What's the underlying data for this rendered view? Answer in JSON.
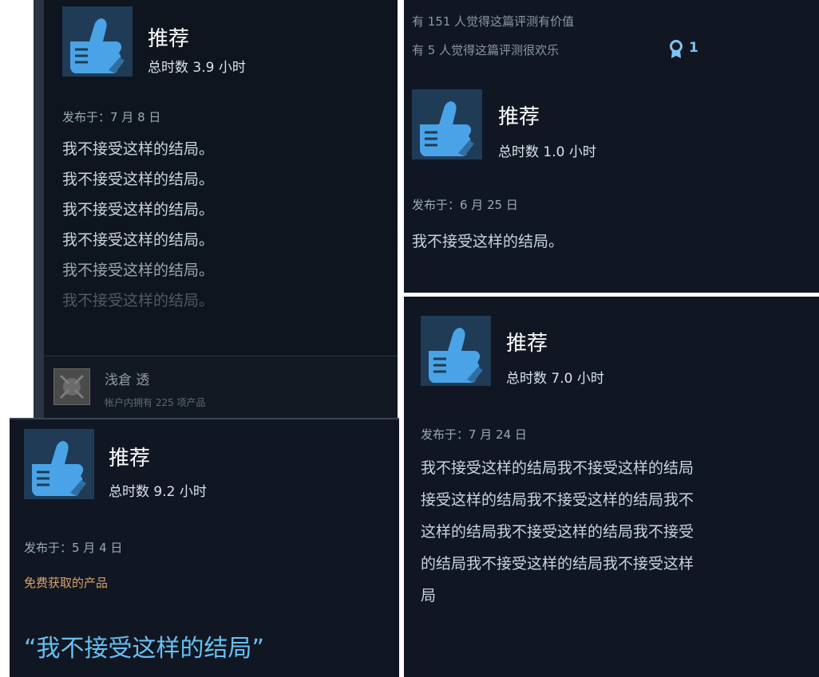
{
  "review_top_left": {
    "recommendation": "推荐",
    "hours": "总时数 3.9 小时",
    "posted": "发布于：7 月 8 日",
    "lines": [
      "我不接受这样的结局。",
      "我不接受这样的结局。",
      "我不接受这样的结局。",
      "我不接受这样的结局。",
      "我不接受这样的结局。",
      "我不接受这样的结局。"
    ],
    "author": {
      "name": "浅倉 透",
      "products": "帐户内拥有 225 项产品"
    }
  },
  "review_top_right": {
    "helpful": "有 151 人觉得这篇评测有价值",
    "funny": "有 5 人觉得这篇评测很欢乐",
    "award_count": "1",
    "recommendation": "推荐",
    "hours": "总时数 1.0 小时",
    "posted": "发布于：6 月 25 日",
    "text": "我不接受这样的结局。"
  },
  "review_bottom_right": {
    "recommendation": "推荐",
    "hours": "总时数 7.0 小时",
    "posted": "发布于：7 月 24 日",
    "lines": [
      "我不接受这样的结局我不接受这样的结局",
      "接受这样的结局我不接受这样的结局我不",
      "这样的结局我不接受这样的结局我不接受",
      "的结局我不接受这样的结局我不接受这样",
      "局"
    ]
  },
  "review_bottom_left": {
    "recommendation": "推荐",
    "hours": "总时数 9.2 小时",
    "posted": "发布于：5 月 4 日",
    "free_label": "免费获取的产品",
    "quote": "“我不接受这样的结局”"
  },
  "icons": {
    "thumb": "thumbs-up-icon",
    "award": "award-ribbon-icon",
    "avatar": "user-avatar"
  },
  "colors": {
    "accent": "#66c0f4",
    "thumb_bg": "#1f3b56",
    "free_product": "#d8a46a"
  }
}
